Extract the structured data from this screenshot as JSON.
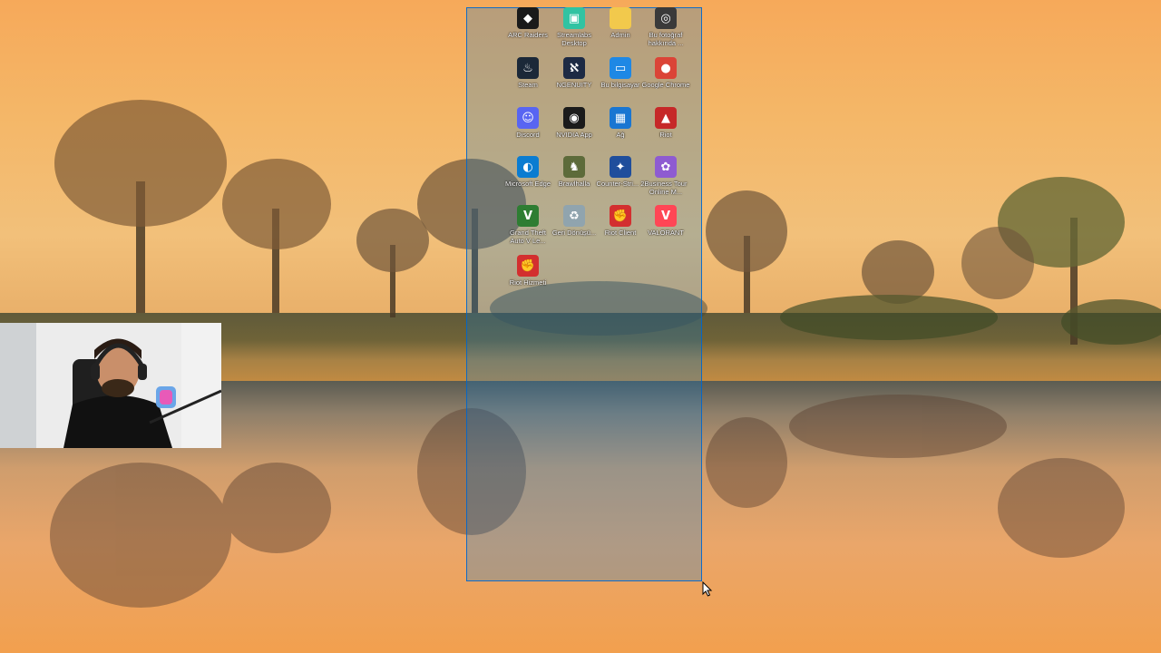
{
  "desktop": {
    "icons": [
      {
        "label": "ARC Raiders",
        "icon": "arc-raiders-icon",
        "color": "#1a1a1a",
        "glyph": "◆"
      },
      {
        "label": "Streamlabs Desktop",
        "icon": "streamlabs-icon",
        "color": "#31c3a2",
        "glyph": "▣"
      },
      {
        "label": "Admin",
        "icon": "folder-icon",
        "color": "#f2c94c",
        "glyph": ""
      },
      {
        "label": "Bu fotoğraf hakkında ...",
        "icon": "camera-icon",
        "color": "#3a3a3a",
        "glyph": "◎"
      },
      {
        "label": "Steam",
        "icon": "steam-icon",
        "color": "#1b2838",
        "glyph": "♨"
      },
      {
        "label": "NGENUITY",
        "icon": "ngenuity-icon",
        "color": "#1d2a44",
        "glyph": "ℵ"
      },
      {
        "label": "Bu bilgisayar",
        "icon": "computer-icon",
        "color": "#1e88e5",
        "glyph": "▭"
      },
      {
        "label": "Google Chrome",
        "icon": "chrome-icon",
        "color": "#db4437",
        "glyph": "●"
      },
      {
        "label": "Discord",
        "icon": "discord-icon",
        "color": "#5865f2",
        "glyph": "☺"
      },
      {
        "label": "NVIDIA App",
        "icon": "nvidia-icon",
        "color": "#1b1b1b",
        "glyph": "◉"
      },
      {
        "label": "Ağ",
        "icon": "network-icon",
        "color": "#1976d2",
        "glyph": "▦"
      },
      {
        "label": "Riot",
        "icon": "riot-folder-icon",
        "color": "#c62828",
        "glyph": "▲"
      },
      {
        "label": "Microsoft Edge",
        "icon": "edge-icon",
        "color": "#0a7cd1",
        "glyph": "◐"
      },
      {
        "label": "Brawlhalla",
        "icon": "brawlhalla-icon",
        "color": "#5d6b3a",
        "glyph": "♞"
      },
      {
        "label": "Counter-Stri... 2",
        "icon": "cs2-icon",
        "color": "#1f4e9c",
        "glyph": "✦"
      },
      {
        "label": "Business Tour Online M...",
        "icon": "business-tour-icon",
        "color": "#8e5bd1",
        "glyph": "✿"
      },
      {
        "label": "Grand Theft Auto V Le...",
        "icon": "gta-icon",
        "color": "#2e7d32",
        "glyph": "V"
      },
      {
        "label": "Geri Dönüşü...",
        "icon": "recycle-bin-icon",
        "color": "#90a4ae",
        "glyph": "♻"
      },
      {
        "label": "Riot Client",
        "icon": "riot-client-icon",
        "color": "#d32f2f",
        "glyph": "✊"
      },
      {
        "label": "VALORANT",
        "icon": "valorant-icon",
        "color": "#ff4655",
        "glyph": "V"
      },
      {
        "label": "Riot Hizmeti",
        "icon": "riot-service-icon",
        "color": "#d32f2f",
        "glyph": "✊"
      }
    ]
  },
  "overlay": {
    "webcam": "webcam-overlay",
    "cursor": "mouse-cursor-icon"
  }
}
